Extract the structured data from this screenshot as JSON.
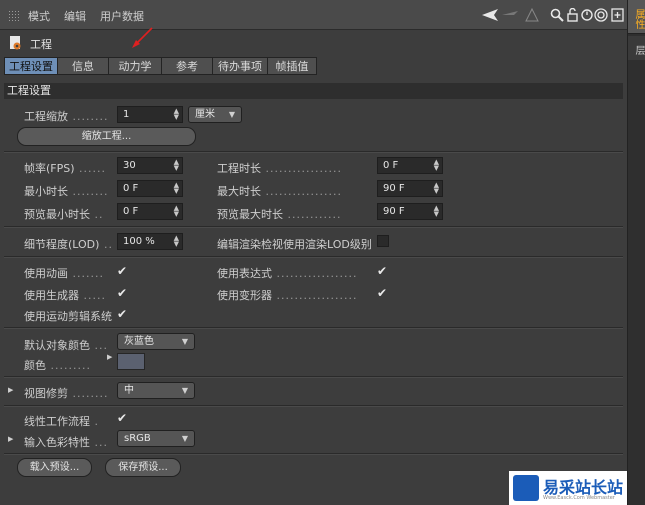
{
  "menu": {
    "items": [
      "模式",
      "编辑",
      "用户数据"
    ]
  },
  "right_strip": {
    "tab1": "属性",
    "tab2": "层"
  },
  "project": {
    "title": "工程"
  },
  "tabs": [
    "工程设置",
    "信息",
    "动力学",
    "参考",
    "待办事项",
    "帧插值"
  ],
  "section_title": "工程设置",
  "scale": {
    "label": "工程缩放",
    "value": "1",
    "unit": "厘米",
    "button": "缩放工程..."
  },
  "time": {
    "fps_label": "帧率(FPS)",
    "fps_value": "30",
    "duration_label": "工程时长",
    "duration_value": "0 F",
    "min_label": "最小时长",
    "min_value": "0 F",
    "max_label": "最大时长",
    "max_value": "90 F",
    "pmin_label": "预览最小时长",
    "pmin_value": "0 F",
    "pmax_label": "预览最大时长",
    "pmax_value": "90 F"
  },
  "lod": {
    "label": "细节程度(LOD)",
    "value": "100 %",
    "render_label": "编辑渲染检视使用渲染LOD级别"
  },
  "flags": {
    "animation": "使用动画",
    "expression": "使用表达式",
    "generator": "使用生成器",
    "deformer": "使用变形器",
    "motion": "使用运动剪辑系统"
  },
  "color": {
    "default_label": "默认对象颜色",
    "default_value": "灰蓝色",
    "color_label": "颜色"
  },
  "clip": {
    "label": "视图修剪",
    "value": "中"
  },
  "linear": {
    "label": "线性工作流程"
  },
  "input_profile": {
    "label": "输入色彩特性",
    "value": "sRGB"
  },
  "buttons": {
    "load": "载入预设...",
    "save": "保存预设..."
  },
  "watermark": {
    "brand": "易采站长站",
    "sub": "Www.Easck.Com Webmaster"
  },
  "colors": {
    "tab_active": "#6e8fb7",
    "annotation_arrow": "#e02020",
    "watermark": "#1b5cb8"
  }
}
